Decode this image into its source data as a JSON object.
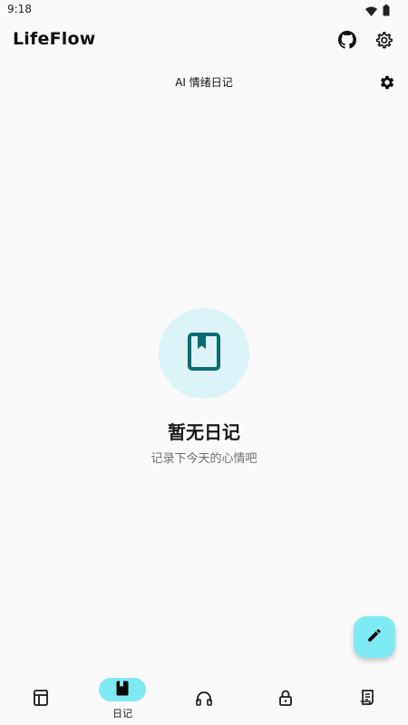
{
  "status_bar": {
    "time": "9:18"
  },
  "app_bar": {
    "title": "LifeFlow"
  },
  "section": {
    "title": "AI 情绪日记"
  },
  "empty_state": {
    "title": "暂无日记",
    "subtitle": "记录下今天的心情吧"
  },
  "bottom_nav": {
    "items": [
      {
        "icon": "calendar-icon",
        "label": "",
        "active": false
      },
      {
        "icon": "book-icon",
        "label": "日记",
        "active": true
      },
      {
        "icon": "headphones-icon",
        "label": "",
        "active": false
      },
      {
        "icon": "lock-icon",
        "label": "",
        "active": false
      },
      {
        "icon": "receipt-icon",
        "label": "",
        "active": false
      }
    ]
  },
  "colors": {
    "accent": "#7feaf4",
    "empty_circle": "#dcf4f8",
    "book_icon": "#0d6b72",
    "background": "#fafafa"
  }
}
